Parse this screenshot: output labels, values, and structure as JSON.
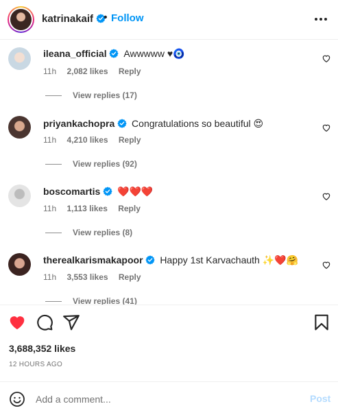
{
  "header": {
    "username": "katrinakaif",
    "separator": "•",
    "follow_label": "Follow"
  },
  "comments": [
    {
      "username": "ileana_official",
      "text": "Awwwww ♥🧿",
      "time": "11h",
      "likes": "2,082 likes",
      "reply_label": "Reply",
      "view_replies": "View replies (17)"
    },
    {
      "username": "priyankachopra",
      "text": "Congratulations so beautiful 😍",
      "time": "11h",
      "likes": "4,210 likes",
      "reply_label": "Reply",
      "view_replies": "View replies (92)"
    },
    {
      "username": "boscomartis",
      "text": "❤️❤️❤️",
      "time": "11h",
      "likes": "1,113 likes",
      "reply_label": "Reply",
      "view_replies": "View replies (8)"
    },
    {
      "username": "therealkarismakapoor",
      "text": "Happy 1st Karvachauth ✨❤️🤗",
      "time": "11h",
      "likes": "3,553 likes",
      "reply_label": "Reply",
      "view_replies": "View replies (41)"
    }
  ],
  "post": {
    "likes": "3,688,352 likes",
    "time_ago": "12 HOURS AGO",
    "liked": true
  },
  "comment_box": {
    "placeholder": "Add a comment...",
    "value": "",
    "post_label": "Post"
  },
  "colors": {
    "accent": "#0095f6",
    "like_red": "#ff3040",
    "post_disabled": "#b3dbff",
    "muted": "#737373"
  },
  "icons": {
    "verified": "verified-badge-icon",
    "more": "more-options-icon",
    "heart": "heart-icon",
    "comment": "comment-icon",
    "share": "share-icon",
    "save": "bookmark-icon",
    "emoji": "emoji-icon"
  }
}
